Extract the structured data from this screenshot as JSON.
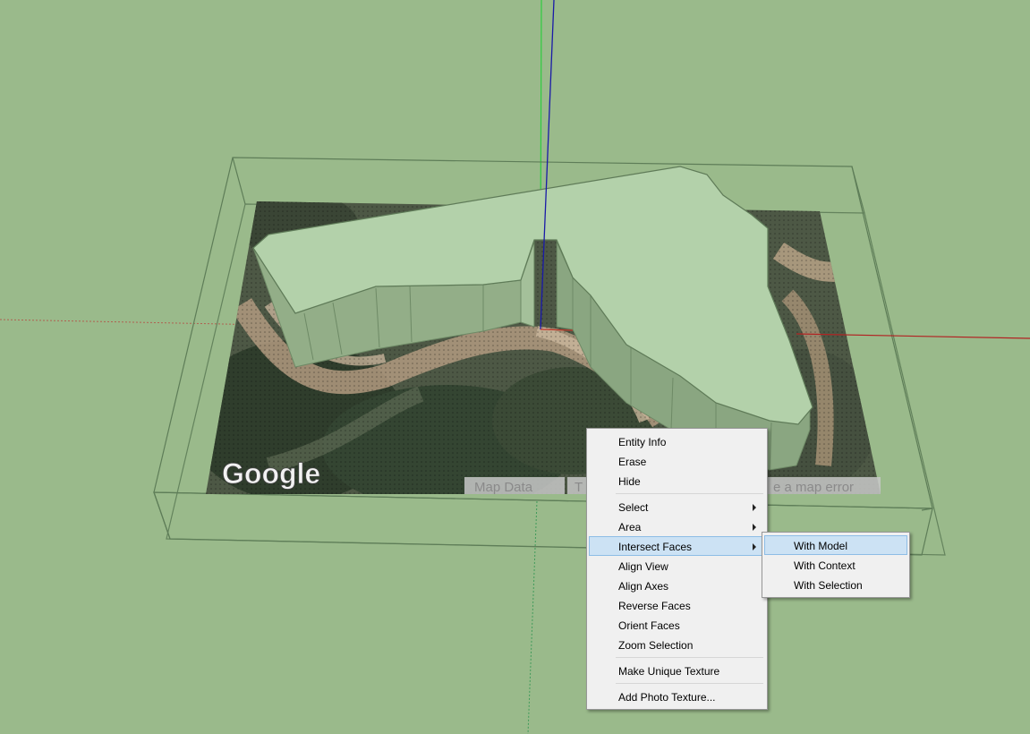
{
  "map": {
    "logo": "Google",
    "attribution": [
      "Map Data",
      "T",
      "e a map error"
    ]
  },
  "context_menu": {
    "groups": [
      [
        {
          "label": "Entity Info"
        },
        {
          "label": "Erase"
        },
        {
          "label": "Hide"
        }
      ],
      [
        {
          "label": "Select",
          "submenu": true
        },
        {
          "label": "Area",
          "submenu": true
        },
        {
          "label": "Intersect Faces",
          "submenu": true,
          "active": true
        },
        {
          "label": "Align View"
        },
        {
          "label": "Align Axes"
        },
        {
          "label": "Reverse Faces"
        },
        {
          "label": "Orient Faces"
        },
        {
          "label": "Zoom Selection"
        }
      ],
      [
        {
          "label": "Make Unique Texture"
        }
      ],
      [
        {
          "label": "Add Photo Texture..."
        }
      ]
    ]
  },
  "submenu": {
    "items": [
      {
        "label": "With Model",
        "active": true
      },
      {
        "label": "With Context"
      },
      {
        "label": "With Selection"
      }
    ]
  },
  "colors": {
    "viewport_background": "#9aba8b",
    "model_face": "#b3d1aa",
    "model_wall": "#8fad85",
    "axis_red": "#c0392b",
    "axis_green": "#2ecc40",
    "axis_blue": "#1a1aa8",
    "menu_highlight": "#cce2f4"
  }
}
